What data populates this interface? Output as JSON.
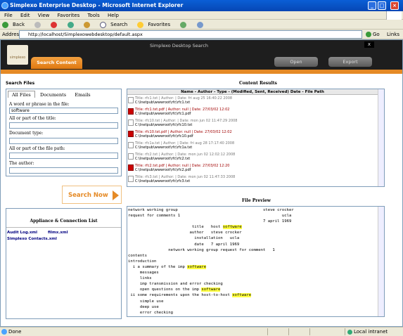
{
  "window": {
    "title": "Simplexo Enterprise Desktop - Microsoft Internet Explorer"
  },
  "menu": [
    "File",
    "Edit",
    "View",
    "Favorites",
    "Tools",
    "Help"
  ],
  "toolbar": {
    "back": "Back",
    "search": "Search",
    "favorites": "Favorites"
  },
  "address": {
    "label": "Address",
    "url": "http://localhost/Simplexowebdesktop/default.aspx",
    "go": "Go",
    "links": "Links"
  },
  "app": {
    "header_title": "Simplexo Desktop Search",
    "logo_text": "simplexo",
    "tab_search": "Search Content",
    "btn_open": "Open",
    "btn_export": "Export",
    "close": "x"
  },
  "search": {
    "title": "Search Files",
    "tabs": [
      "All Files",
      "Documents",
      "Emails"
    ],
    "fields": [
      {
        "label": "A word or phrase in the file:",
        "value": "software"
      },
      {
        "label": "All or part of the title:",
        "value": ""
      },
      {
        "label": "Document type:",
        "value": ""
      },
      {
        "label": "All or part of the file path:",
        "value": ""
      },
      {
        "label": "The author:",
        "value": ""
      }
    ],
    "button": "Search Now"
  },
  "appliance": {
    "title": "Appliance & Connection List",
    "links": [
      "Audit Log.xml",
      "filmx.xml",
      "Simplexo Contacts.xml"
    ]
  },
  "results": {
    "title": "Content Results",
    "header": "Name  -  Author  -  Type  -  (Modified, Sent, Received) Date  -  File Path",
    "rows": [
      {
        "line1": "Title: rfc1.txt | Author: | Date: fri aug 25 16:40:22 2008",
        "line2": "C:\\Inetpub\\wwwroot\\rfc\\rfc1.txt",
        "type": "txt",
        "color": "grey"
      },
      {
        "line1": "Title: rfc1.txt.pdf | Author: null | Date: 27/03/02 12:02",
        "line2": "C:\\Inetpub\\wwwroot\\rfc\\rfc1.pdf",
        "type": "pdf",
        "color": "red"
      },
      {
        "line1": "Title: rfc10.txt | Author: | Date: mon jun 02 11:47:29 2008",
        "line2": "C:\\Inetpub\\wwwroot\\rfc\\rfc10.txt",
        "type": "txt",
        "color": "grey"
      },
      {
        "line1": "Title: rfc10.txt.pdf | Author: null | Date: 27/03/02 12:02",
        "line2": "C:\\Inetpub\\wwwroot\\rfc\\rfc10.pdf",
        "type": "pdf",
        "color": "red"
      },
      {
        "line1": "Title: rfc1a.txt | Author: | Date: fri aug 28 17:17:40 2008",
        "line2": "C:\\Inetpub\\wwwroot\\rfc\\rfc1a.txt",
        "type": "txt",
        "color": "grey"
      },
      {
        "line1": "Title: rfc2.txt | Author: | Date: mon jun 02 12:02:12 2008",
        "line2": "C:\\Inetpub\\wwwroot\\rfc\\rfc2.txt",
        "type": "txt",
        "color": "grey"
      },
      {
        "line1": "Title: rfc2.txt.pdf | Author: null | Date: 27/03/02 12:20",
        "line2": "C:\\Inetpub\\wwwroot\\rfc\\rfc2.pdf",
        "type": "pdf",
        "color": "red"
      },
      {
        "line1": "Title: rfc3.txt | Author: | Date: mon jun 02 11:47:33 2008",
        "line2": "C:\\Inetpub\\wwwroot\\rfc\\rfc3.txt",
        "type": "txt",
        "color": "grey"
      }
    ]
  },
  "preview": {
    "title": "File Preview",
    "lines": [
      [
        {
          "t": "network working group                                    steve crocker"
        }
      ],
      [
        {
          "t": "request for comments 1                                           ucla"
        }
      ],
      [
        {
          "t": "                                                         7 april 1969"
        }
      ],
      [
        {
          "t": "                           title   host "
        },
        {
          "t": "software",
          "h": true
        }
      ],
      [
        {
          "t": "                          author   steve crocker"
        }
      ],
      [
        {
          "t": "                            installation   ucla"
        }
      ],
      [
        {
          "t": "                            date   7 april 1969"
        }
      ],
      [
        {
          "t": "                 network working group request for comment   1"
        }
      ],
      [
        {
          "t": "contents"
        }
      ],
      [
        {
          "t": "introduction"
        }
      ],
      [
        {
          "t": "  i a summary of the imp "
        },
        {
          "t": "software",
          "h": true
        }
      ],
      [
        {
          "t": "     messages"
        }
      ],
      [
        {
          "t": "     links"
        }
      ],
      [
        {
          "t": "     imp transmission and error checking"
        }
      ],
      [
        {
          "t": "     open questions on the imp "
        },
        {
          "t": "software",
          "h": true
        }
      ],
      [
        {
          "t": " ii some requirements upon the host-to-host "
        },
        {
          "t": "software",
          "h": true
        }
      ],
      [
        {
          "t": "     simple use"
        }
      ],
      [
        {
          "t": "     deep use"
        }
      ],
      [
        {
          "t": "     error checking"
        }
      ]
    ]
  },
  "status": {
    "text": "Done",
    "zone": "Local intranet"
  }
}
